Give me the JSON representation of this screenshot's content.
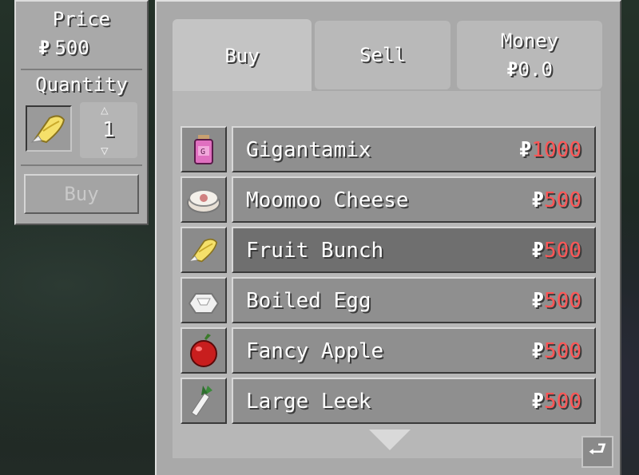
{
  "currency_symbol": "₽",
  "left_panel": {
    "price_label": "Price",
    "price_value": "500",
    "quantity_label": "Quantity",
    "quantity_value": "1",
    "selected_item_icon": "fruit-bunch-icon",
    "buy_button_label": "Buy"
  },
  "tabs": {
    "buy": "Buy",
    "sell": "Sell",
    "money_label": "Money",
    "money_value": "0.0"
  },
  "items": [
    {
      "name": "Gigantamix",
      "price": "1000",
      "icon": "gigantamix-icon"
    },
    {
      "name": "Moomoo Cheese",
      "price": "500",
      "icon": "moomoo-cheese-icon"
    },
    {
      "name": "Fruit Bunch",
      "price": "500",
      "icon": "fruit-bunch-icon"
    },
    {
      "name": "Boiled Egg",
      "price": "500",
      "icon": "boiled-egg-icon"
    },
    {
      "name": "Fancy Apple",
      "price": "500",
      "icon": "fancy-apple-icon"
    },
    {
      "name": "Large Leek",
      "price": "500",
      "icon": "large-leek-icon"
    }
  ],
  "selected_index": 2,
  "colors": {
    "price_red": "#ff5555"
  }
}
